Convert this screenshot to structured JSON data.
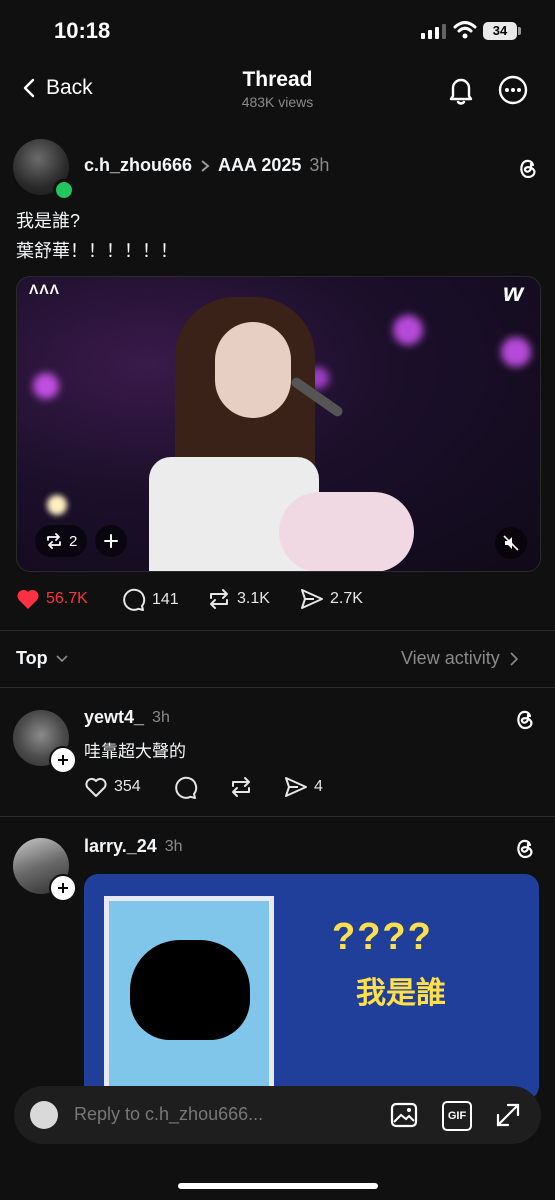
{
  "status": {
    "time": "10:18",
    "battery": "34"
  },
  "nav": {
    "back_label": "Back",
    "title": "Thread",
    "views": "483K views"
  },
  "post": {
    "username": "c.h_zhou666",
    "community": "AAA 2025",
    "time": "3h",
    "lines": [
      "我是誰?",
      "葉舒華！！！！！！"
    ],
    "media": {
      "repost_count": "2",
      "badge_text": "w"
    },
    "stats": {
      "likes": "56.7K",
      "comments": "141",
      "reposts": "3.1K",
      "shares": "2.7K"
    }
  },
  "sort": {
    "label": "Top",
    "view_activity": "View activity"
  },
  "replies": [
    {
      "username": "yewt4_",
      "time": "3h",
      "text": "哇靠超大聲的",
      "likes": "354",
      "shares": "4"
    },
    {
      "username": "larry._24",
      "time": "3h",
      "meme_q": "????",
      "meme_text": "我是誰"
    }
  ],
  "composer": {
    "placeholder": "Reply to c.h_zhou666...",
    "gif_label": "GIF"
  },
  "colors": {
    "like_red": "#ff3040",
    "online_green": "#22c55e"
  }
}
